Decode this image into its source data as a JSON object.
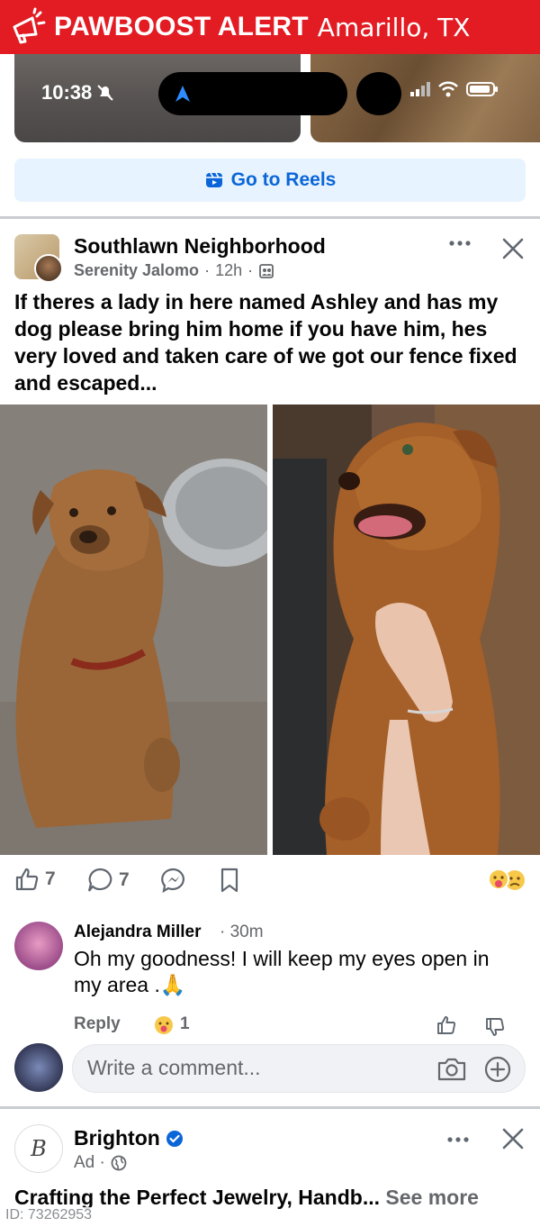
{
  "alert": {
    "brand": "PAWBOOST ALERT",
    "city": "Amarillo, TX",
    "icon": "megaphone-icon"
  },
  "status_bar": {
    "time": "10:38"
  },
  "reels": {
    "label": "Go to Reels"
  },
  "post": {
    "group": "Southlawn Neighborhood",
    "author": "Serenity Jalomo",
    "time": "12h",
    "body": "If theres a lady in here named Ashley and has my dog please bring him home if you have him, hes very loved and taken care of we got our fence fixed and escaped...",
    "likes": "7",
    "comments": "7"
  },
  "comment": {
    "name": "Alejandra Miller",
    "time": "· 30m",
    "text": "Oh my goodness! I will keep my eyes open in my area .🙏",
    "reply_label": "Reply",
    "reaction_count": "1",
    "input_placeholder": "Write a comment..."
  },
  "ad": {
    "name": "Brighton",
    "meta": "Ad ·",
    "logo_letter": "B",
    "text": "Crafting the Perfect Jewelry, Handb...",
    "see_more": "See more"
  },
  "footer": {
    "id_label": "ID: 73262953"
  },
  "colors": {
    "alert_red": "#e31b23",
    "fb_blue": "#0a66d8",
    "reels_bg": "#e7f3ff",
    "meta_gray": "#65676b"
  }
}
